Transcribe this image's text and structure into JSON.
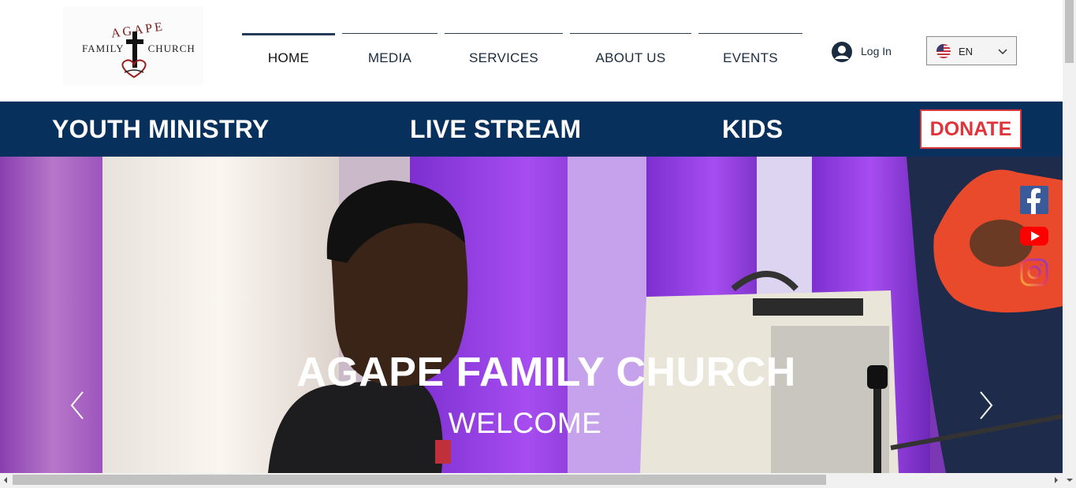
{
  "logo": {
    "top_text": "AGAPE",
    "left_text": "FAMILY",
    "right_text": "CHURCH"
  },
  "nav": {
    "items": [
      {
        "label": "HOME",
        "active": true
      },
      {
        "label": "MEDIA",
        "active": false
      },
      {
        "label": "SERVICES",
        "active": false
      },
      {
        "label": "ABOUT US",
        "active": false
      },
      {
        "label": "EVENTS",
        "active": false
      }
    ]
  },
  "login": {
    "label": "Log In",
    "icon": "user-icon"
  },
  "language": {
    "selected": "EN",
    "flag": "us-flag-icon"
  },
  "banner": {
    "links": [
      "YOUTH MINISTRY",
      "LIVE STREAM",
      "KIDS"
    ],
    "donate_label": "DONATE",
    "background": "#07305d",
    "donate_color": "#e0333a"
  },
  "hero": {
    "title": "AGAPE FAMILY CHURCH",
    "subtitle": "WELCOME",
    "prev_icon": "chevron-left-icon",
    "next_icon": "chevron-right-icon"
  },
  "social": [
    "facebook-icon",
    "youtube-icon",
    "instagram-icon"
  ]
}
